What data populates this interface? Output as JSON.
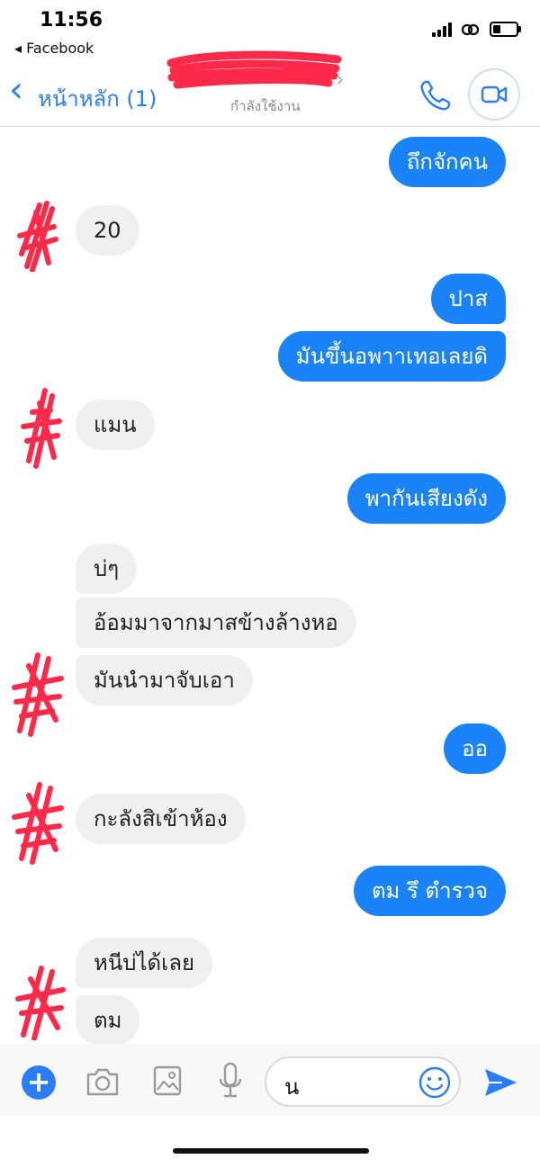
{
  "status_bar": {
    "time": "11:56",
    "back_app": "◂ Facebook"
  },
  "header": {
    "back_label": "หน้าหลัก (1)",
    "active_status": "กำลังใช้งาน"
  },
  "messages": [
    {
      "side": "out",
      "text": "ถึกจักคน"
    },
    {
      "side": "in",
      "text": "20"
    },
    {
      "side": "out",
      "text": "ปาส"
    },
    {
      "side": "out",
      "text": "มันขึ้นอพาาเทอเลยดิ"
    },
    {
      "side": "in",
      "text": "แมน"
    },
    {
      "side": "out",
      "text": "พากันเสียงดัง"
    },
    {
      "side": "in",
      "text": "บ่ๆ"
    },
    {
      "side": "in",
      "text": "อ้อมมาจากมาสข้างล้างหอ"
    },
    {
      "side": "in",
      "text": "มันนำมาจับเอา"
    },
    {
      "side": "out",
      "text": "ออ"
    },
    {
      "side": "in",
      "text": "กะลังสิเข้าห้อง"
    },
    {
      "side": "out",
      "text": "ตม รึ ตำรวจ"
    },
    {
      "side": "in",
      "text": "หนีบ่ได้เลย"
    },
    {
      "side": "in",
      "text": "ตม"
    }
  ],
  "composer": {
    "input_value": "น"
  },
  "icons": {
    "back": "chevron-left-icon",
    "call": "phone-icon",
    "video": "video-camera-icon",
    "plus": "plus-icon",
    "camera": "camera-icon",
    "gallery": "image-icon",
    "mic": "microphone-icon",
    "emoji": "smiley-icon",
    "send": "send-icon"
  },
  "colors": {
    "accent": "#1a83f7",
    "incoming_bubble": "#f0f0f0",
    "redaction": "#ff2a4a"
  }
}
